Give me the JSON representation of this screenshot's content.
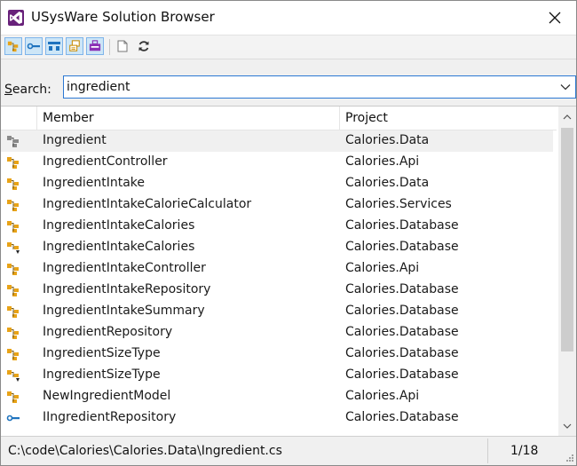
{
  "window": {
    "title": "USysWare Solution Browser"
  },
  "toolbar": {
    "buttons": [
      {
        "name": "class-filter",
        "icon": "class-icon",
        "active": true
      },
      {
        "name": "interface-filter",
        "icon": "interface-icon",
        "active": true
      },
      {
        "name": "struct-filter",
        "icon": "struct-icon",
        "active": true
      },
      {
        "name": "enum-filter",
        "icon": "enum-icon",
        "active": true
      },
      {
        "name": "delegate-filter",
        "icon": "delegate-icon",
        "active": true
      },
      {
        "name": "file-filter",
        "icon": "file-icon",
        "active": false
      },
      {
        "name": "refresh",
        "icon": "refresh-icon",
        "active": false
      }
    ]
  },
  "search": {
    "label_prefix": "",
    "label_accel": "S",
    "label_rest": "earch:",
    "value": "ingredient"
  },
  "grid": {
    "columns": [
      "Member",
      "Project"
    ],
    "rows": [
      {
        "icon": "class-icon-gray",
        "member": "Ingredient",
        "project": "Calories.Data",
        "selected": true
      },
      {
        "icon": "class-icon",
        "member": "IngredientController",
        "project": "Calories.Api"
      },
      {
        "icon": "class-icon",
        "member": "IngredientIntake",
        "project": "Calories.Data"
      },
      {
        "icon": "class-icon",
        "member": "IngredientIntakeCalorieCalculator",
        "project": "Calories.Services"
      },
      {
        "icon": "class-icon",
        "member": "IngredientIntakeCalories",
        "project": "Calories.Database"
      },
      {
        "icon": "class-sealed-icon",
        "member": "IngredientIntakeCalories",
        "project": "Calories.Database"
      },
      {
        "icon": "class-icon",
        "member": "IngredientIntakeController",
        "project": "Calories.Api"
      },
      {
        "icon": "class-icon",
        "member": "IngredientIntakeRepository",
        "project": "Calories.Database"
      },
      {
        "icon": "class-icon",
        "member": "IngredientIntakeSummary",
        "project": "Calories.Database"
      },
      {
        "icon": "class-icon",
        "member": "IngredientRepository",
        "project": "Calories.Database"
      },
      {
        "icon": "class-icon",
        "member": "IngredientSizeType",
        "project": "Calories.Database"
      },
      {
        "icon": "class-sealed-icon",
        "member": "IngredientSizeType",
        "project": "Calories.Database"
      },
      {
        "icon": "class-icon",
        "member": "NewIngredientModel",
        "project": "Calories.Api"
      },
      {
        "icon": "interface-icon",
        "member": "IIngredientRepository",
        "project": "Calories.Database"
      }
    ]
  },
  "status": {
    "path": "C:\\code\\Calories\\Calories.Data\\Ingredient.cs",
    "count": "1/18"
  },
  "colors": {
    "class_orange": "#e8a317",
    "interface_blue": "#1e73be",
    "selection": "#f0f0f0",
    "accent_border": "#2b78d3",
    "vs_purple": "#68217a"
  }
}
